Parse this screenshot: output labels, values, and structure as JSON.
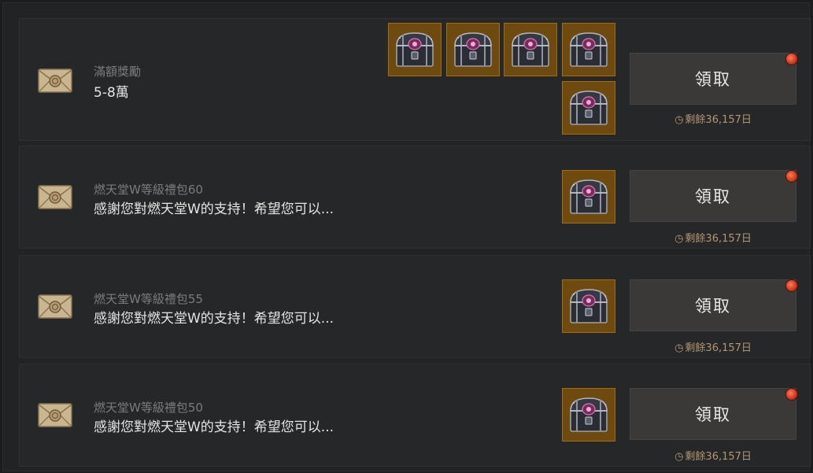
{
  "claim_label": "領取",
  "remain_text": "剩餘36,157日",
  "colors": {
    "background": "#222324",
    "row": "#262728",
    "item_bg": "#6e4a0e",
    "item_border": "#a06c1c",
    "button": "#3a3938",
    "remain_text": "#b39670",
    "notify_dot": "#d63a1e"
  },
  "mails": [
    {
      "subtitle": "滿額獎勵",
      "title": "5-8萬",
      "icon": "envelope-seal-icon",
      "items": [
        "treasure-chest-icon",
        "treasure-chest-icon",
        "treasure-chest-icon",
        "treasure-chest-icon",
        "treasure-chest-icon"
      ]
    },
    {
      "subtitle": "燃天堂W等級禮包60",
      "title": "感謝您對燃天堂W的支持！希望您可以...",
      "icon": "envelope-seal-icon",
      "items": [
        "treasure-chest-icon"
      ]
    },
    {
      "subtitle": "燃天堂W等級禮包55",
      "title": "感謝您對燃天堂W的支持！希望您可以...",
      "icon": "envelope-seal-icon",
      "items": [
        "treasure-chest-icon"
      ]
    },
    {
      "subtitle": "燃天堂W等級禮包50",
      "title": "感謝您對燃天堂W的支持！希望您可以...",
      "icon": "envelope-seal-icon",
      "items": [
        "treasure-chest-icon"
      ]
    }
  ]
}
